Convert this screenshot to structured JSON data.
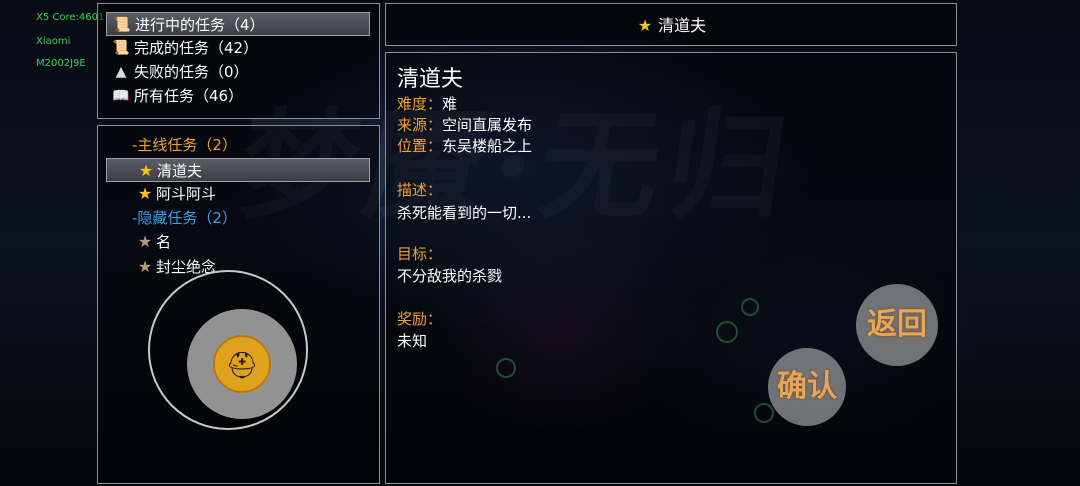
{
  "debug": {
    "core": "X5 Core:4601",
    "brand": "Xiaomi",
    "model": "M2002J9E"
  },
  "background": {
    "watermark": "梦魇·无归"
  },
  "categories": [
    {
      "icon": "scroll-open-icon",
      "glyph": "📜",
      "label": "进行中的任务（4）",
      "selected": true
    },
    {
      "icon": "scroll-rolled-icon",
      "glyph": "📜",
      "label": "完成的任务（42）",
      "selected": false
    },
    {
      "icon": "failed-flag-icon",
      "glyph": "▲",
      "label": "失败的任务（0）",
      "selected": false
    },
    {
      "icon": "book-icon",
      "glyph": "📖",
      "label": "所有任务（46）",
      "selected": false
    }
  ],
  "tasks": {
    "main_group": "-主线任务（2）",
    "main_items": [
      "清道夫",
      "阿斗阿斗"
    ],
    "hidden_group": "-隐藏任务（2）",
    "hidden_items": [
      "名",
      "封尘绝念"
    ]
  },
  "header": {
    "title": "清道夫"
  },
  "detail": {
    "name": "清道夫",
    "difficulty_label": "难度：",
    "difficulty": "难",
    "source_label": "来源：",
    "source": "空间直属发布",
    "location_label": "位置：",
    "location": "东吴楼船之上",
    "desc_label": "描述：",
    "desc": "杀死能看到的一切...",
    "goal_label": "目标：",
    "goal": "不分敌我的杀戮",
    "reward_label": "奖励：",
    "reward": "未知"
  },
  "buttons": {
    "back": "返回",
    "confirm": "确认"
  },
  "colors": {
    "accent_orange": "#f0a030",
    "hidden_blue": "#3f9fe0",
    "star_gold": "#f5c518"
  }
}
